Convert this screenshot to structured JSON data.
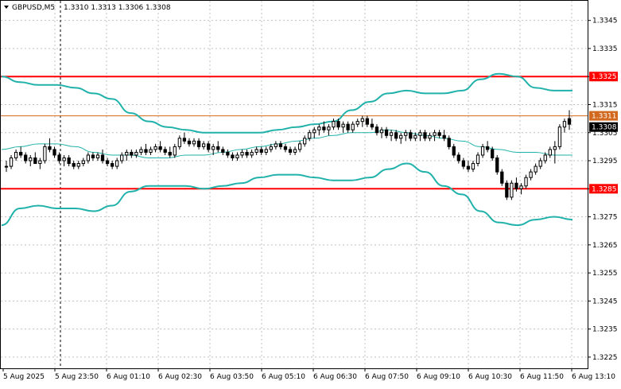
{
  "header": {
    "symbol": "GBPUSD,M5",
    "ohlc": "1.3310 1.3313 1.3306 1.3308"
  },
  "colors": {
    "candle": "#000000",
    "bollinger_outer": "#20b2aa",
    "bollinger_middle": "#20b2aa",
    "support_resistance": "#ff0000",
    "price_line": "#d2691e",
    "grid": "#c0c0c0",
    "badge_level": "#ff0000",
    "badge_price": "#000000"
  },
  "chart_data": {
    "type": "candlestick",
    "ylim": [
      1.3221,
      1.3352
    ],
    "y_ticks": [
      "1.3345",
      "1.3335",
      "1.3325",
      "1.3315",
      "1.3305",
      "1.3295",
      "1.3285",
      "1.3275",
      "1.3265",
      "1.3255",
      "1.3245",
      "1.3235",
      "1.3225"
    ],
    "x_labels": [
      "5 Aug 2025",
      "5 Aug 23:50",
      "6 Aug 01:10",
      "6 Aug 02:30",
      "6 Aug 03:50",
      "6 Aug 05:10",
      "6 Aug 06:30",
      "6 Aug 07:50",
      "6 Aug 09:10",
      "6 Aug 10:30",
      "6 Aug 11:50",
      "6 Aug 13:10"
    ],
    "candles": [
      [
        1.3293,
        1.3295,
        1.3291,
        1.3293
      ],
      [
        1.3293,
        1.3297,
        1.3292,
        1.3296
      ],
      [
        1.3296,
        1.3299,
        1.3295,
        1.3298
      ],
      [
        1.3298,
        1.33,
        1.3296,
        1.3297
      ],
      [
        1.3297,
        1.3298,
        1.3294,
        1.3295
      ],
      [
        1.3295,
        1.3297,
        1.3293,
        1.3296
      ],
      [
        1.3296,
        1.3298,
        1.3294,
        1.3294
      ],
      [
        1.3294,
        1.3296,
        1.3292,
        1.3295
      ],
      [
        1.3295,
        1.3301,
        1.3294,
        1.33
      ],
      [
        1.33,
        1.3303,
        1.3298,
        1.3299
      ],
      [
        1.3299,
        1.33,
        1.3296,
        1.3297
      ],
      [
        1.3297,
        1.3298,
        1.3294,
        1.3295
      ],
      [
        1.3295,
        1.3297,
        1.3293,
        1.3296
      ],
      [
        1.3296,
        1.3297,
        1.3293,
        1.3294
      ],
      [
        1.3294,
        1.3295,
        1.3292,
        1.3293
      ],
      [
        1.3293,
        1.3295,
        1.3292,
        1.3294
      ],
      [
        1.3294,
        1.3296,
        1.3293,
        1.3295
      ],
      [
        1.3295,
        1.3298,
        1.3294,
        1.3297
      ],
      [
        1.3297,
        1.3298,
        1.3295,
        1.3296
      ],
      [
        1.3296,
        1.3298,
        1.3295,
        1.3297
      ],
      [
        1.3297,
        1.3299,
        1.3294,
        1.3295
      ],
      [
        1.3295,
        1.3296,
        1.3293,
        1.3294
      ],
      [
        1.3294,
        1.3295,
        1.3292,
        1.3293
      ],
      [
        1.3293,
        1.3296,
        1.3292,
        1.3295
      ],
      [
        1.3295,
        1.3298,
        1.3294,
        1.3297
      ],
      [
        1.3297,
        1.3299,
        1.3295,
        1.3298
      ],
      [
        1.3298,
        1.3299,
        1.3296,
        1.3297
      ],
      [
        1.3297,
        1.3299,
        1.3296,
        1.3298
      ],
      [
        1.3298,
        1.33,
        1.3297,
        1.3299
      ],
      [
        1.3299,
        1.3301,
        1.3297,
        1.3298
      ],
      [
        1.3298,
        1.33,
        1.3297,
        1.3299
      ],
      [
        1.3299,
        1.3301,
        1.3298,
        1.33
      ],
      [
        1.33,
        1.3302,
        1.3298,
        1.3299
      ],
      [
        1.3299,
        1.33,
        1.3297,
        1.3298
      ],
      [
        1.3298,
        1.33,
        1.3296,
        1.3297
      ],
      [
        1.3297,
        1.3301,
        1.3296,
        1.33
      ],
      [
        1.33,
        1.3304,
        1.3299,
        1.3303
      ],
      [
        1.3303,
        1.3305,
        1.3301,
        1.3302
      ],
      [
        1.3302,
        1.3303,
        1.33,
        1.3301
      ],
      [
        1.3301,
        1.3303,
        1.33,
        1.3302
      ],
      [
        1.3302,
        1.3303,
        1.3299,
        1.33
      ],
      [
        1.33,
        1.3302,
        1.3299,
        1.3301
      ],
      [
        1.3301,
        1.3302,
        1.3298,
        1.3299
      ],
      [
        1.3299,
        1.3301,
        1.3297,
        1.33
      ],
      [
        1.33,
        1.3302,
        1.3298,
        1.3299
      ],
      [
        1.3299,
        1.33,
        1.3297,
        1.3298
      ],
      [
        1.3298,
        1.3299,
        1.3296,
        1.3297
      ],
      [
        1.3297,
        1.3298,
        1.3295,
        1.3296
      ],
      [
        1.3296,
        1.3298,
        1.3295,
        1.3297
      ],
      [
        1.3297,
        1.3299,
        1.3296,
        1.3298
      ],
      [
        1.3298,
        1.3299,
        1.3296,
        1.3297
      ],
      [
        1.3297,
        1.3299,
        1.3296,
        1.3298
      ],
      [
        1.3298,
        1.33,
        1.3297,
        1.3299
      ],
      [
        1.3299,
        1.33,
        1.3297,
        1.3298
      ],
      [
        1.3298,
        1.33,
        1.3297,
        1.3299
      ],
      [
        1.3299,
        1.3301,
        1.3298,
        1.33
      ],
      [
        1.33,
        1.3302,
        1.3299,
        1.3301
      ],
      [
        1.3301,
        1.3302,
        1.3299,
        1.33
      ],
      [
        1.33,
        1.3301,
        1.3298,
        1.3299
      ],
      [
        1.3299,
        1.33,
        1.3297,
        1.3298
      ],
      [
        1.3298,
        1.33,
        1.3297,
        1.3299
      ],
      [
        1.3299,
        1.3302,
        1.3298,
        1.3301
      ],
      [
        1.3301,
        1.3304,
        1.33,
        1.3303
      ],
      [
        1.3303,
        1.3306,
        1.3302,
        1.3305
      ],
      [
        1.3305,
        1.3307,
        1.3303,
        1.3306
      ],
      [
        1.3306,
        1.3308,
        1.3304,
        1.3307
      ],
      [
        1.3307,
        1.3309,
        1.3305,
        1.3306
      ],
      [
        1.3306,
        1.3308,
        1.3304,
        1.3307
      ],
      [
        1.3307,
        1.331,
        1.3306,
        1.3309
      ],
      [
        1.3309,
        1.331,
        1.3306,
        1.3307
      ],
      [
        1.3307,
        1.3309,
        1.3305,
        1.3308
      ],
      [
        1.3308,
        1.3309,
        1.3305,
        1.3306
      ],
      [
        1.3306,
        1.3309,
        1.3305,
        1.3308
      ],
      [
        1.3308,
        1.331,
        1.3307,
        1.3309
      ],
      [
        1.3309,
        1.3311,
        1.3307,
        1.331
      ],
      [
        1.331,
        1.3311,
        1.3307,
        1.3308
      ],
      [
        1.3308,
        1.331,
        1.3306,
        1.3307
      ],
      [
        1.3307,
        1.3308,
        1.3304,
        1.3305
      ],
      [
        1.3305,
        1.3307,
        1.3303,
        1.3306
      ],
      [
        1.3306,
        1.3307,
        1.3303,
        1.3304
      ],
      [
        1.3304,
        1.3306,
        1.3302,
        1.3305
      ],
      [
        1.3305,
        1.3306,
        1.3302,
        1.3303
      ],
      [
        1.3303,
        1.3305,
        1.3301,
        1.3304
      ],
      [
        1.3304,
        1.3306,
        1.3302,
        1.3305
      ],
      [
        1.3305,
        1.3306,
        1.3302,
        1.3303
      ],
      [
        1.3303,
        1.3305,
        1.3302,
        1.3304
      ],
      [
        1.3304,
        1.3306,
        1.3302,
        1.3305
      ],
      [
        1.3305,
        1.3306,
        1.3302,
        1.3303
      ],
      [
        1.3303,
        1.3305,
        1.3302,
        1.3304
      ],
      [
        1.3304,
        1.3306,
        1.3302,
        1.3305
      ],
      [
        1.3305,
        1.3306,
        1.3303,
        1.3304
      ],
      [
        1.3304,
        1.3306,
        1.3302,
        1.3303
      ],
      [
        1.3303,
        1.3304,
        1.3299,
        1.33
      ],
      [
        1.33,
        1.3301,
        1.3296,
        1.3297
      ],
      [
        1.3297,
        1.3298,
        1.3294,
        1.3295
      ],
      [
        1.3295,
        1.3296,
        1.3292,
        1.3293
      ],
      [
        1.3293,
        1.3295,
        1.3291,
        1.3292
      ],
      [
        1.3292,
        1.3295,
        1.3291,
        1.3294
      ],
      [
        1.3294,
        1.3298,
        1.3293,
        1.3297
      ],
      [
        1.3297,
        1.3301,
        1.3296,
        1.33
      ],
      [
        1.33,
        1.3302,
        1.3298,
        1.3299
      ],
      [
        1.3299,
        1.33,
        1.3295,
        1.3296
      ],
      [
        1.3296,
        1.3297,
        1.329,
        1.3291
      ],
      [
        1.3291,
        1.3292,
        1.3286,
        1.3287
      ],
      [
        1.3287,
        1.3288,
        1.3281,
        1.3282
      ],
      [
        1.3282,
        1.3288,
        1.3281,
        1.3287
      ],
      [
        1.3287,
        1.3289,
        1.3284,
        1.3285
      ],
      [
        1.3285,
        1.3287,
        1.3283,
        1.3286
      ],
      [
        1.3286,
        1.329,
        1.3285,
        1.3289
      ],
      [
        1.3289,
        1.3292,
        1.3288,
        1.3291
      ],
      [
        1.3291,
        1.3294,
        1.329,
        1.3293
      ],
      [
        1.3293,
        1.3296,
        1.3292,
        1.3295
      ],
      [
        1.3295,
        1.3298,
        1.3294,
        1.3297
      ],
      [
        1.3297,
        1.33,
        1.3296,
        1.3299
      ],
      [
        1.3299,
        1.3302,
        1.3294,
        1.33
      ],
      [
        1.33,
        1.3308,
        1.3299,
        1.3307
      ],
      [
        1.3307,
        1.331,
        1.3305,
        1.3309
      ],
      [
        1.331,
        1.3313,
        1.3306,
        1.3308
      ]
    ],
    "bollinger_upper": [
      1.3325,
      1.3323,
      1.3322,
      1.3322,
      1.3321,
      1.3319,
      1.3317,
      1.3312,
      1.3309,
      1.3307,
      1.3306,
      1.3305,
      1.3305,
      1.3305,
      1.3305,
      1.3306,
      1.3307,
      1.3308,
      1.3309,
      1.3313,
      1.3316,
      1.3319,
      1.332,
      1.3319,
      1.3319,
      1.332,
      1.3324,
      1.3326,
      1.3325,
      1.3321,
      1.332,
      1.332
    ],
    "bollinger_middle": [
      1.3299,
      1.33,
      1.3301,
      1.3301,
      1.33,
      1.3298,
      1.3297,
      1.3297,
      1.3296,
      1.3296,
      1.3297,
      1.3297,
      1.3298,
      1.3299,
      1.33,
      1.3301,
      1.3302,
      1.3303,
      1.3304,
      1.3305,
      1.3305,
      1.3306,
      1.3305,
      1.3304,
      1.3303,
      1.3302,
      1.33,
      1.3299,
      1.3298,
      1.3298,
      1.3297,
      1.3297
    ],
    "bollinger_lower": [
      1.3272,
      1.3278,
      1.3279,
      1.3278,
      1.3278,
      1.3277,
      1.3279,
      1.3284,
      1.3286,
      1.3286,
      1.3286,
      1.3285,
      1.3286,
      1.3287,
      1.3289,
      1.329,
      1.329,
      1.3289,
      1.3288,
      1.3288,
      1.3289,
      1.3292,
      1.3294,
      1.3291,
      1.3286,
      1.3283,
      1.3277,
      1.3273,
      1.3272,
      1.3274,
      1.3275,
      1.3274
    ],
    "support_resistance": [
      1.3325,
      1.3285
    ],
    "price_line": 1.3311,
    "level_badges": [
      "1.3325",
      "1.3285"
    ],
    "price_badges": [
      "1.3311",
      "1.3308"
    ],
    "grid": true,
    "dashed_vertical_at_label": "5 Aug 23:50"
  }
}
